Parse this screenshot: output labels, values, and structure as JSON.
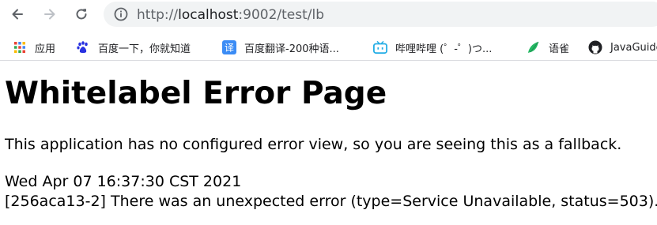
{
  "browser": {
    "url_scheme": "http://",
    "url_host": "localhost",
    "url_path": ":9002/test/lb"
  },
  "bookmarks": [
    {
      "label": "应用",
      "icon": "apps-grid-icon"
    },
    {
      "label": "百度一下，你就知道",
      "icon": "baidu-paw-icon"
    },
    {
      "label": "百度翻译-200种语...",
      "icon": "baidu-translate-icon"
    },
    {
      "label": "哔哩哔哩 (゜-゜)つ...",
      "icon": "bilibili-tv-icon"
    },
    {
      "label": "语雀",
      "icon": "yuque-bird-icon"
    },
    {
      "label": "JavaGuide",
      "icon": "github-icon"
    }
  ],
  "page": {
    "title": "Whitelabel Error Page",
    "message": "This application has no configured error view, so you are seeing this as a fallback.",
    "timestamp": "Wed Apr 07 16:37:30 CST 2021",
    "error": "[256aca13-2] There was an unexpected error (type=Service Unavailable, status=503)."
  },
  "colors": {
    "toolbar_icon": "#5f6368",
    "omnibox_bg": "#f1f3f4",
    "baidu_blue": "#2932e1",
    "translate_blue": "#3b8cf5",
    "bilibili_blue": "#23ade5",
    "yuque_green": "#25b864"
  }
}
